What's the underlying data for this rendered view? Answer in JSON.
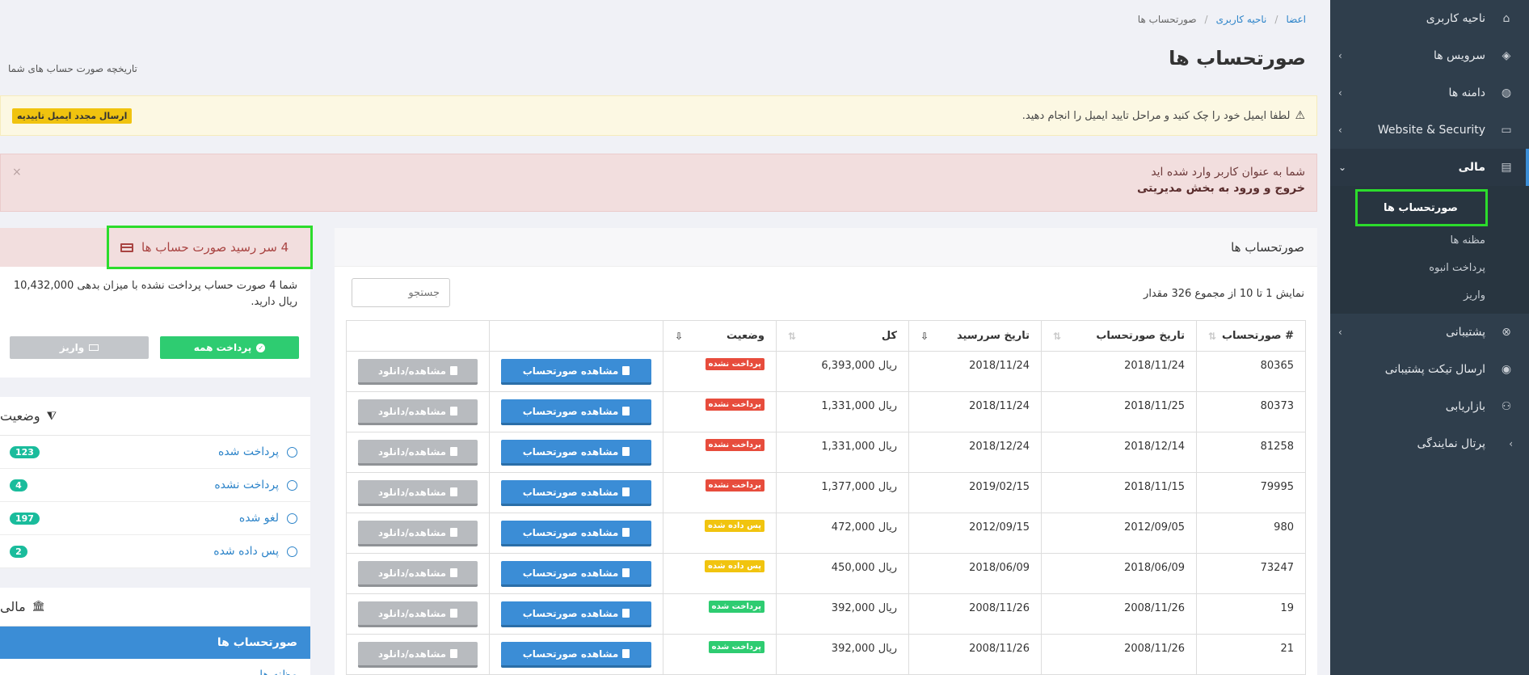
{
  "breadcrumb": [
    "اعضا",
    "ناحیه کاربری",
    "صورتحساب ها"
  ],
  "page": {
    "title": "صورتحساب ها",
    "subtitle": "تاریخچه صورت حساب های شما"
  },
  "alerts": {
    "warning_text": "لطفا ایمیل خود را چک کنید و مراحل تایید ایمیل را انجام دهید.",
    "warning_button": "ارسال مجدد ایمیل تاییدیه",
    "danger_line1": "شما به عنوان کاربر وارد شده اید",
    "danger_line2": "خروج و ورود به بخش مدیریتی",
    "close": "×"
  },
  "sidebar": {
    "items": [
      {
        "label": "ناحیه کاربری",
        "icon": "home-icon",
        "glyph": "⌂"
      },
      {
        "label": "سرویس ها",
        "icon": "cube-icon",
        "glyph": "◈",
        "chevron": "‹"
      },
      {
        "label": "دامنه ها",
        "icon": "globe-icon",
        "glyph": "◍",
        "chevron": "‹"
      },
      {
        "label": "Website & Security",
        "icon": "monitor-icon",
        "glyph": "▭",
        "chevron": "‹"
      },
      {
        "label": "مالی",
        "icon": "file-icon",
        "glyph": "▤",
        "chevron": "⌄"
      }
    ],
    "sub": [
      "صورتحساب ها",
      "مظنه ها",
      "پرداخت انبوه",
      "واریز"
    ],
    "items_after": [
      {
        "label": "پشتیبانی",
        "icon": "support-icon",
        "glyph": "⊗",
        "chevron": "‹"
      },
      {
        "label": "ارسال تیکت پشتیبانی",
        "icon": "comment-icon",
        "glyph": "◉"
      },
      {
        "label": "بازاریابی",
        "icon": "users-icon",
        "glyph": "⚇"
      },
      {
        "label": "پرتال نمایندگی",
        "icon": "chevron-icon",
        "glyph": "",
        "chevron": "‹"
      }
    ]
  },
  "due": {
    "heading": "4  سر رسید صورت حساب ها",
    "text": "شما 4 صورت حساب پرداخت نشده با میزان بدهی 10,432,000 ریال دارید.",
    "pay_all": "پرداخت همه",
    "deposit": "واریز"
  },
  "status_filter": {
    "title": "وضعیت",
    "items": [
      {
        "label": "پرداخت شده",
        "count": "123"
      },
      {
        "label": "پرداخت نشده",
        "count": "4"
      },
      {
        "label": "لغو شده",
        "count": "197"
      },
      {
        "label": "پس داده شده",
        "count": "2"
      }
    ]
  },
  "finance_menu": {
    "title": "مالی",
    "active": "صورتحساب ها",
    "next": "مظنه ها"
  },
  "invoices": {
    "panel_title": "صورتحساب ها",
    "search_placeholder": "جستجو",
    "info": "نمایش 1 تا 10 از مجموع 326 مقدار",
    "columns": [
      "صورتحساب #",
      "تاریخ صورتحساب",
      "تاریخ سررسید",
      "کل",
      "وضعیت",
      "",
      ""
    ],
    "view_label": "مشاهده صورتحساب",
    "download_label": "مشاهده/دانلود",
    "rows": [
      {
        "id": "80365",
        "date": "2018/11/24",
        "due": "2018/11/24",
        "total": "6,393,000 ریال",
        "status": "پرداخت نشده",
        "kind": "unpaid"
      },
      {
        "id": "80373",
        "date": "2018/11/25",
        "due": "2018/11/24",
        "total": "1,331,000 ریال",
        "status": "پرداخت نشده",
        "kind": "unpaid"
      },
      {
        "id": "81258",
        "date": "2018/12/14",
        "due": "2018/12/24",
        "total": "1,331,000 ریال",
        "status": "پرداخت نشده",
        "kind": "unpaid"
      },
      {
        "id": "79995",
        "date": "2018/11/15",
        "due": "2019/02/15",
        "total": "1,377,000 ریال",
        "status": "پرداخت نشده",
        "kind": "unpaid"
      },
      {
        "id": "980",
        "date": "2012/09/05",
        "due": "2012/09/15",
        "total": "472,000 ریال",
        "status": "پس داده شده",
        "kind": "refund"
      },
      {
        "id": "73247",
        "date": "2018/06/09",
        "due": "2018/06/09",
        "total": "450,000 ریال",
        "status": "پس داده شده",
        "kind": "refund"
      },
      {
        "id": "19",
        "date": "2008/11/26",
        "due": "2008/11/26",
        "total": "392,000 ریال",
        "status": "پرداخت شده",
        "kind": "paid"
      },
      {
        "id": "21",
        "date": "2008/11/26",
        "due": "2008/11/26",
        "total": "392,000 ریال",
        "status": "پرداخت شده",
        "kind": "paid"
      }
    ]
  },
  "colors": {
    "sidebar_bg": "#2f3e4c",
    "primary": "#3b8dd6",
    "success": "#2ecc71",
    "danger": "#e74c3c",
    "warning": "#f1c40f",
    "highlight": "#2cdc2c"
  }
}
